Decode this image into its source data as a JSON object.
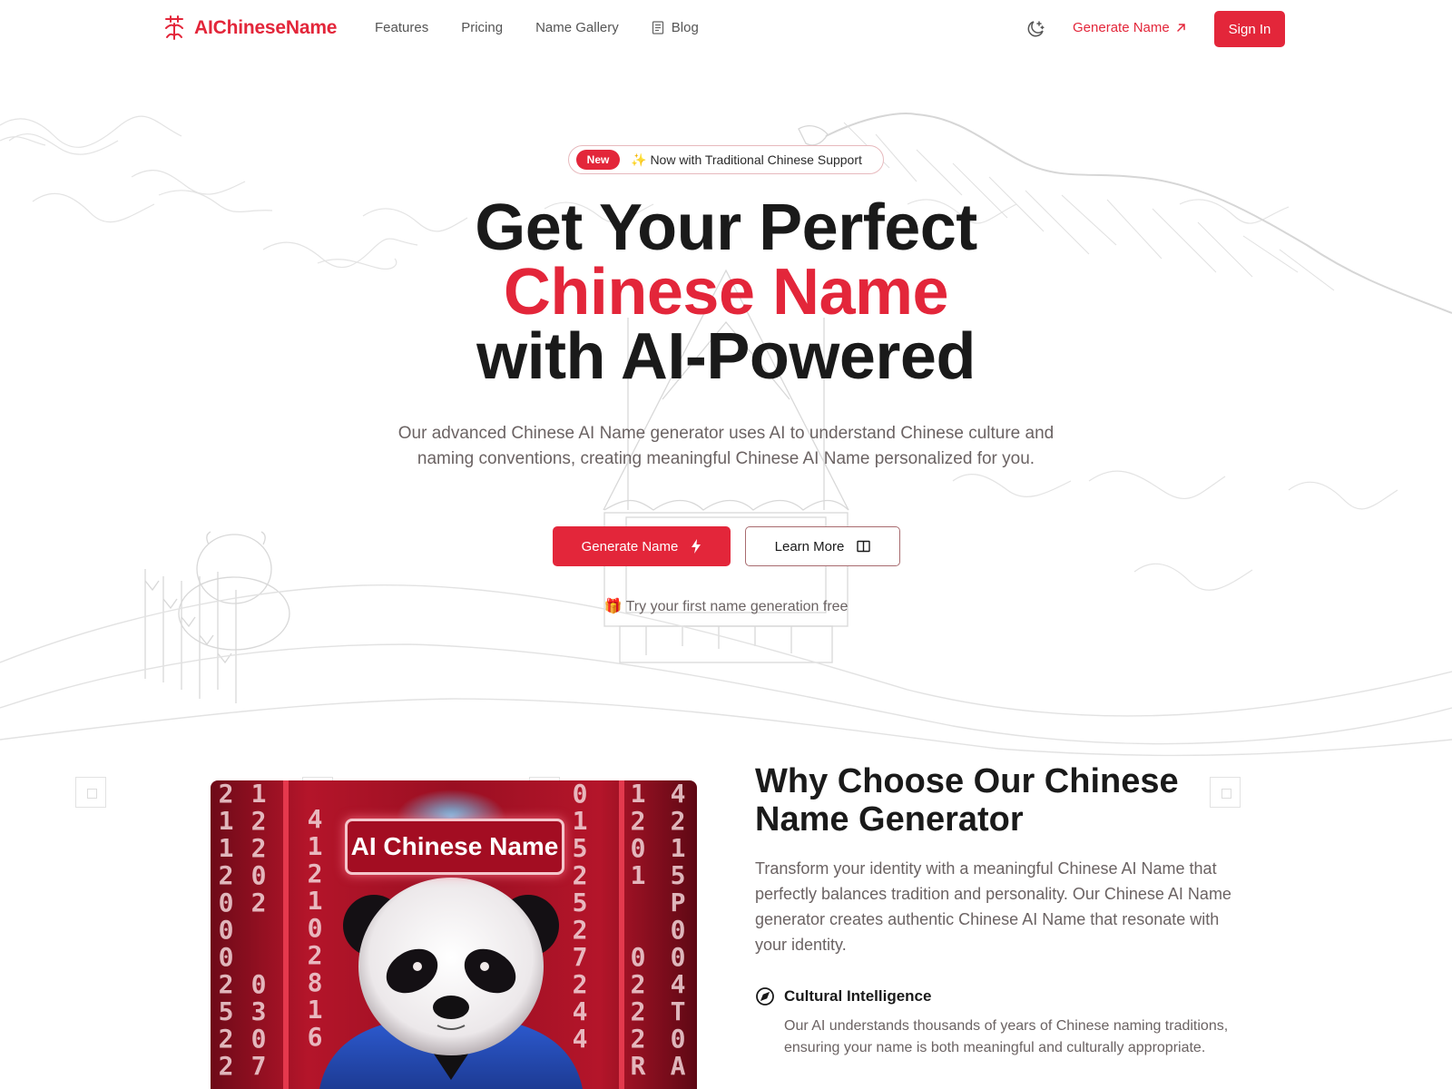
{
  "header": {
    "brand": "AIChineseName",
    "nav": [
      {
        "label": "Features"
      },
      {
        "label": "Pricing"
      },
      {
        "label": "Name Gallery"
      },
      {
        "label": "Blog",
        "icon": "document-icon"
      }
    ],
    "theme_toggle_icon": "moon-stars-icon",
    "generate_link": "Generate Name",
    "generate_link_icon": "arrow-up-right-icon",
    "sign_in": "Sign In"
  },
  "hero": {
    "badge_pill": "New",
    "badge_emoji": "✨",
    "badge_text": "Now with Traditional Chinese Support",
    "title_line1": "Get Your Perfect",
    "title_line2": "Chinese Name",
    "title_line3": "with AI-Powered",
    "subtitle": "Our advanced Chinese AI Name generator uses AI to understand Chinese culture and naming conventions, creating meaningful Chinese AI Name personalized for you.",
    "primary_button": "Generate Name",
    "primary_button_icon": "lightning-icon",
    "secondary_button": "Learn More",
    "secondary_button_icon": "book-open-icon",
    "free_note_emoji": "🎁",
    "free_note": "Try your first name generation free"
  },
  "why": {
    "image_label": "AI Chinese Name",
    "title": "Why Choose Our Chinese Name Generator",
    "description": "Transform your identity with a meaningful Chinese AI Name that perfectly balances tradition and personality. Our Chinese AI Name generator creates authentic Chinese AI Name that resonate with your identity.",
    "features": [
      {
        "icon": "compass-icon",
        "title": "Cultural Intelligence",
        "description": "Our AI understands thousands of years of Chinese naming traditions, ensuring your name is both meaningful and culturally appropriate."
      }
    ]
  },
  "colors": {
    "brand_red": "#e3263a",
    "text_dark": "#1a1a1a",
    "text_muted": "#6b6363"
  }
}
